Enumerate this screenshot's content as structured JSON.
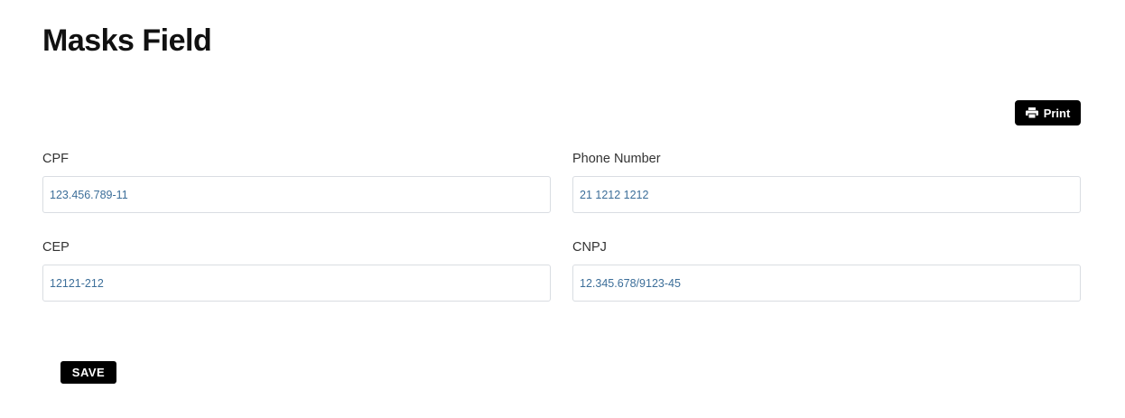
{
  "page": {
    "title": "Masks Field"
  },
  "toolbar": {
    "print_label": "Print",
    "print_icon": "printer-icon"
  },
  "form": {
    "fields": [
      {
        "label": "CPF",
        "value": "123.456.789-11"
      },
      {
        "label": "Phone Number",
        "value": "21 1212 1212"
      },
      {
        "label": "CEP",
        "value": "12121-212"
      },
      {
        "label": "CNPJ",
        "value": "12.345.678/9123-45"
      }
    ],
    "save_label": "SAVE"
  },
  "colors": {
    "button_background": "#000000",
    "button_text": "#ffffff",
    "input_text": "#3c6e99",
    "input_border": "#d9dde2"
  }
}
